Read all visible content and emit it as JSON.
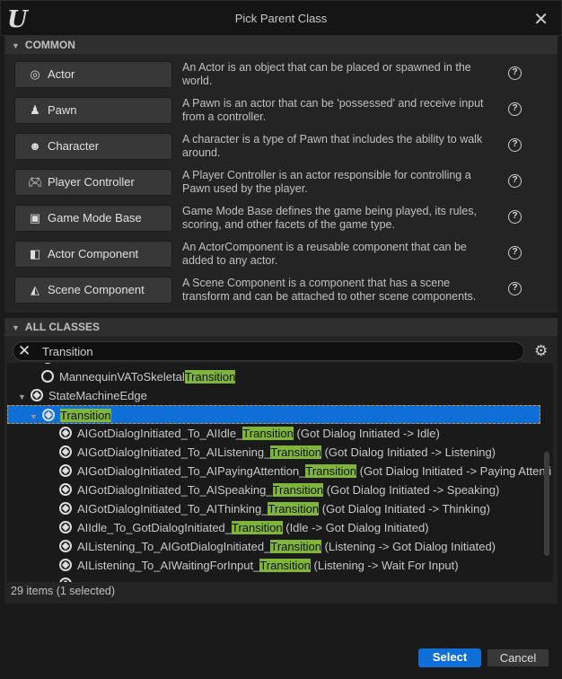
{
  "window": {
    "title": "Pick Parent Class",
    "logo": "U",
    "close_icon": "close-icon"
  },
  "common": {
    "header": "COMMON",
    "items": [
      {
        "label": "Actor",
        "icon": "actor-icon",
        "glyph": "◎",
        "desc": "An Actor is an object that can be placed or spawned in the world."
      },
      {
        "label": "Pawn",
        "icon": "pawn-icon",
        "glyph": "♟",
        "desc": "A Pawn is an actor that can be 'possessed' and receive input from a controller."
      },
      {
        "label": "Character",
        "icon": "character-icon",
        "glyph": "☻",
        "desc": "A character is a type of Pawn that includes the ability to walk around."
      },
      {
        "label": "Player Controller",
        "icon": "gamepad-icon",
        "glyph": "🎮︎",
        "desc": "A Player Controller is an actor responsible for controlling a Pawn used by the player."
      },
      {
        "label": "Game Mode Base",
        "icon": "game-mode-icon",
        "glyph": "▣",
        "desc": "Game Mode Base defines the game being played, its rules, scoring, and other facets of the game type."
      },
      {
        "label": "Actor Component",
        "icon": "actor-component-icon",
        "glyph": "◧",
        "desc": "An ActorComponent is a reusable component that can be added to any actor."
      },
      {
        "label": "Scene Component",
        "icon": "scene-component-icon",
        "glyph": "◭",
        "desc": "A Scene Component is a component that has a scene transform and can be attached to other scene components."
      }
    ]
  },
  "all_classes": {
    "header": "ALL CLASSES",
    "search_value": "Transition",
    "search_placeholder": "",
    "highlight_color": "#7fb63a",
    "selection_color": "#0e6fd8",
    "tree": [
      {
        "level": 1,
        "pre": "",
        "match": "",
        "post": "",
        "icon": "gear",
        "partial": true
      },
      {
        "level": 1,
        "pre": "MannequinVAToSkeletal",
        "match": "Transition",
        "post": "",
        "icon": "ring"
      },
      {
        "level": 0,
        "pre": "StateMachineEdge",
        "match": "",
        "post": "",
        "icon": "cube",
        "expanded": true
      },
      {
        "level": 1,
        "pre": "",
        "match": "Transition",
        "post": "",
        "icon": "cube",
        "expanded": true,
        "selected": true
      },
      {
        "level": 2,
        "pre": "AIGotDialogInitiated_To_AIIdle_",
        "match": "Transition",
        "post": " (Got Dialog Initiated -> Idle)",
        "icon": "cube"
      },
      {
        "level": 2,
        "pre": "AIGotDialogInitiated_To_AIListening_",
        "match": "Transition",
        "post": " (Got Dialog Initiated -> Listening)",
        "icon": "cube"
      },
      {
        "level": 2,
        "pre": "AIGotDialogInitiated_To_AIPayingAttention_",
        "match": "Transition",
        "post": " (Got Dialog Initiated -> Paying Attenti",
        "icon": "cube"
      },
      {
        "level": 2,
        "pre": "AIGotDialogInitiated_To_AISpeaking_",
        "match": "Transition",
        "post": " (Got Dialog Initiated -> Speaking)",
        "icon": "cube"
      },
      {
        "level": 2,
        "pre": "AIGotDialogInitiated_To_AIThinking_",
        "match": "Transition",
        "post": " (Got Dialog Initiated -> Thinking)",
        "icon": "cube"
      },
      {
        "level": 2,
        "pre": "AIIdle_To_GotDialogInitiated_",
        "match": "Transition",
        "post": " (Idle -> Got Dialog Initiated)",
        "icon": "cube"
      },
      {
        "level": 2,
        "pre": "AIListening_To_AIGotDialogInitiated_",
        "match": "Transition",
        "post": " (Listening -> Got Dialog Initiated)",
        "icon": "cube"
      },
      {
        "level": 2,
        "pre": "AIListening_To_AIWaitingForInput_",
        "match": "Transition",
        "post": " (Listening -> Wait For Input)",
        "icon": "cube"
      },
      {
        "level": 2,
        "pre": "",
        "match": "",
        "post": "",
        "icon": "cube",
        "partial": true
      }
    ],
    "status": "29 items (1 selected)"
  },
  "footer": {
    "select": "Select",
    "cancel": "Cancel"
  }
}
